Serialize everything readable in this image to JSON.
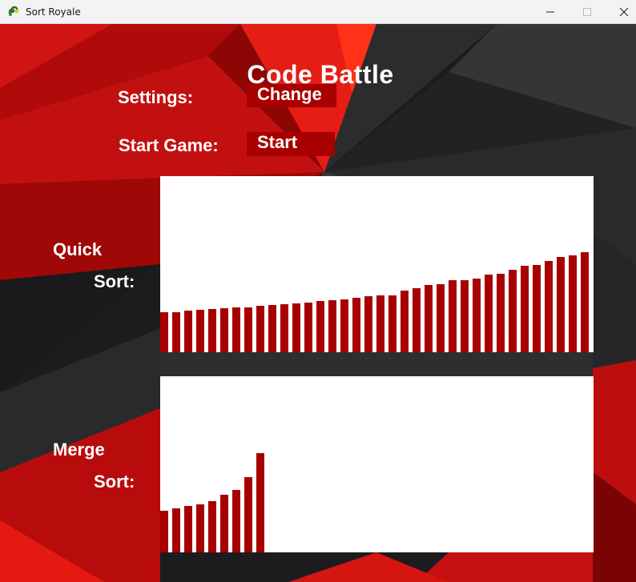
{
  "window": {
    "title": "Sort Royale",
    "icon": "pygame-snake-icon",
    "controls": [
      "minimize-icon",
      "maximize-icon",
      "close-icon"
    ]
  },
  "game": {
    "heading": "Code Battle",
    "settings_label": "Settings:",
    "settings_button": "Change",
    "start_label": "Start Game:",
    "start_button": "Start"
  },
  "colors": {
    "bar": "#a80000",
    "button": "#a80000",
    "panel": "#ffffff"
  },
  "sorts": [
    {
      "label_line1": "Quick",
      "label_line2": "Sort:",
      "bars": [
        0.42,
        0.42,
        0.43,
        0.44,
        0.45,
        0.46,
        0.47,
        0.47,
        0.48,
        0.49,
        0.5,
        0.51,
        0.52,
        0.53,
        0.54,
        0.55,
        0.57,
        0.58,
        0.59,
        0.59,
        0.64,
        0.67,
        0.7,
        0.71,
        0.75,
        0.75,
        0.77,
        0.81,
        0.82,
        0.86,
        0.9,
        0.91,
        0.95,
        0.99,
        1.01,
        1.04
      ]
    },
    {
      "label_line1": "Merge",
      "label_line2": "Sort:",
      "bars": [
        0.43,
        0.46,
        0.48,
        0.5,
        0.53,
        0.6,
        0.65,
        0.78,
        1.03
      ]
    }
  ]
}
